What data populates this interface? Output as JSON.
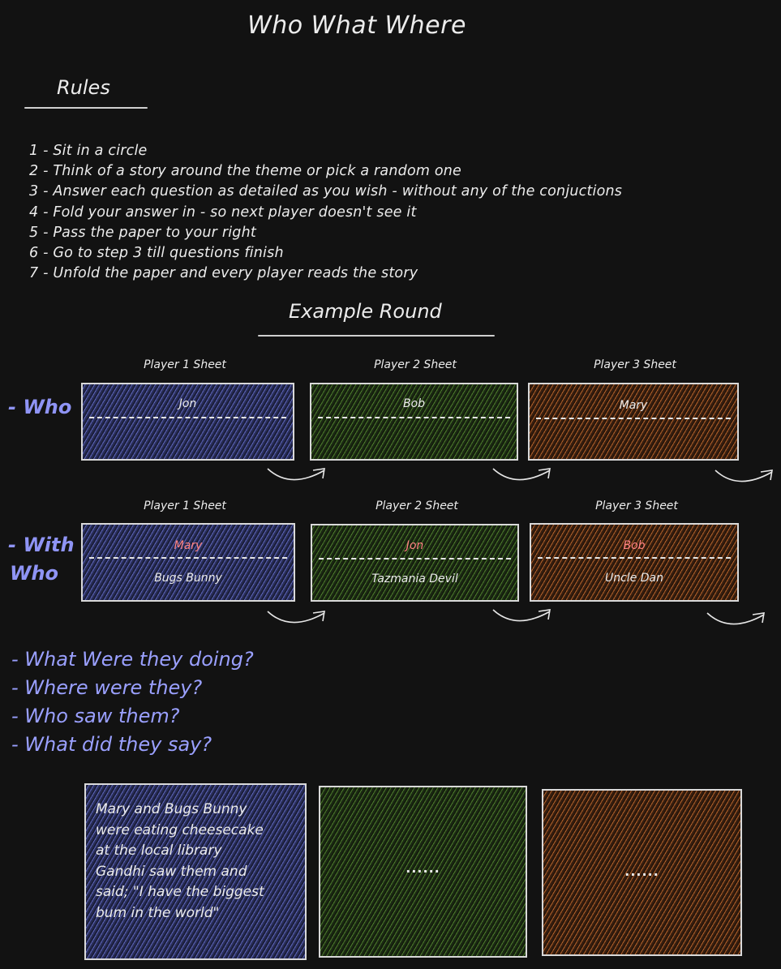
{
  "title": "Who What Where",
  "rules": {
    "heading": "Rules",
    "items": [
      "1 - Sit in a circle",
      "2 - Think of a story around the theme or pick a random one",
      "3 - Answer each question as detailed as you wish - without any of the conjuctions",
      "4 - Fold your answer in - so next player doesn't see it",
      "5 - Pass the paper to your right",
      "6 - Go to step 3 till questions finish",
      "7 - Unfold the paper and every player reads the story"
    ]
  },
  "example": {
    "heading": "Example Round",
    "colors": {
      "player1": "#5c64b8",
      "player2": "#4c7a2c",
      "player3": "#b0602a",
      "hidden_answer": "#ff8383",
      "question": "#9aa0ff"
    },
    "round1": {
      "label": "- Who",
      "sheets": [
        {
          "label": "Player 1 Sheet",
          "answer": "Jon"
        },
        {
          "label": "Player 2 Sheet",
          "answer": "Bob"
        },
        {
          "label": "Player 3 Sheet",
          "answer": "Mary"
        }
      ]
    },
    "round2": {
      "label_line1": "- With",
      "label_line2": "Who",
      "sheets": [
        {
          "label": "Player 1 Sheet",
          "folded": "Mary",
          "answer": "Bugs Bunny"
        },
        {
          "label": "Player 2 Sheet",
          "folded": "Jon",
          "answer": "Tazmania Devil"
        },
        {
          "label": "Player 3 Sheet",
          "folded": "Bob",
          "answer": "Uncle Dan"
        }
      ]
    },
    "questions": [
      "- What Were they doing?",
      "- Where were they?",
      "- Who saw them?",
      "- What did they say?"
    ],
    "results": [
      {
        "story": [
          "Mary and Bugs Bunny",
          "were eating cheesecake",
          "at the local library",
          "Gandhi saw them and",
          "said; \"I have the biggest",
          "bum in the world\""
        ]
      },
      {
        "placeholder": "......"
      },
      {
        "placeholder": "......"
      }
    ]
  }
}
